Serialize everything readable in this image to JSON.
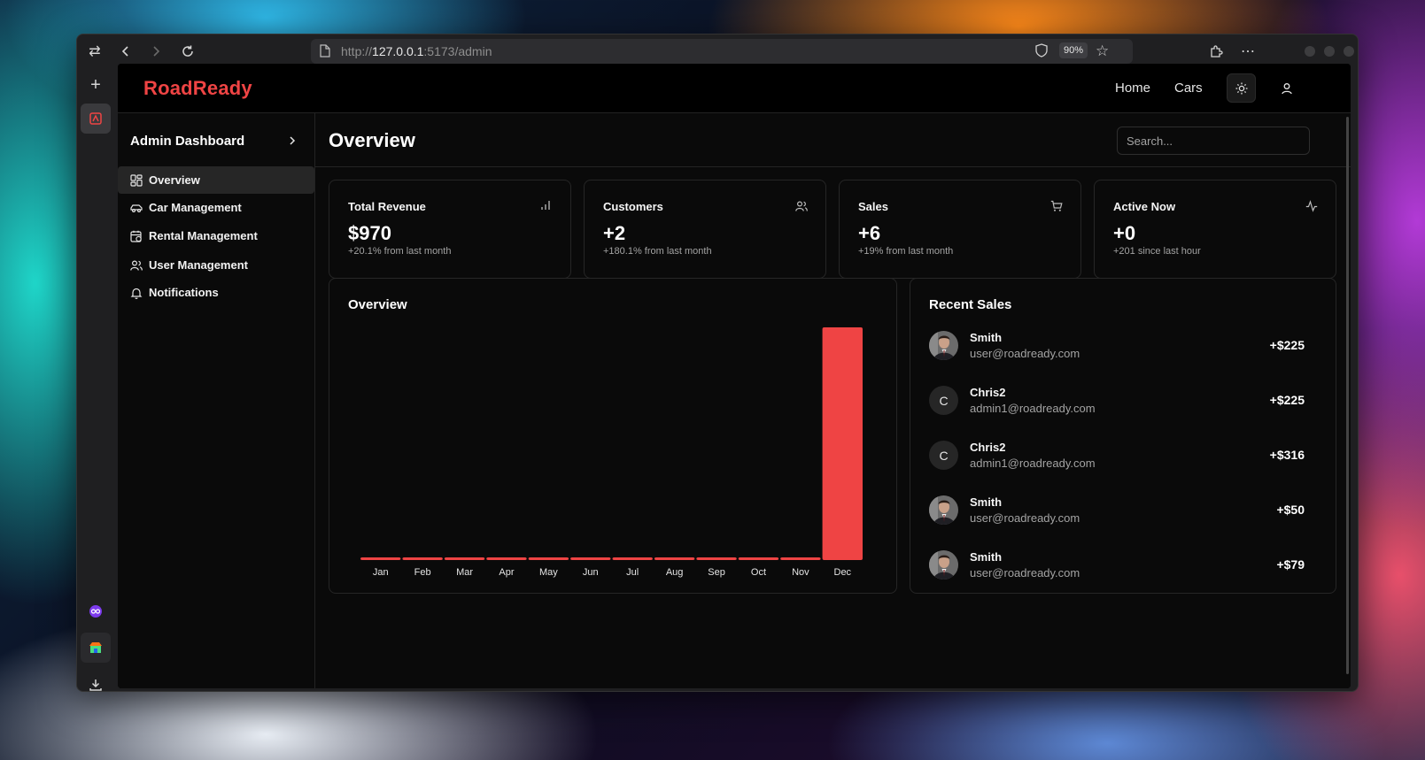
{
  "browser": {
    "url_scheme": "http://",
    "url_host": "127.0.0.1",
    "url_rest": ":5173/admin",
    "zoom": "90%"
  },
  "header": {
    "logo": "RoadReady",
    "nav": [
      "Home",
      "Cars"
    ]
  },
  "sidebar": {
    "title": "Admin Dashboard",
    "items": [
      {
        "label": "Overview",
        "icon": "layout-dashboard-icon",
        "active": true
      },
      {
        "label": "Car Management",
        "icon": "car-icon",
        "active": false
      },
      {
        "label": "Rental Management",
        "icon": "calendar-clock-icon",
        "active": false
      },
      {
        "label": "User Management",
        "icon": "users-icon",
        "active": false
      },
      {
        "label": "Notifications",
        "icon": "bell-icon",
        "active": false
      }
    ]
  },
  "main": {
    "title": "Overview",
    "search_placeholder": "Search...",
    "stats": [
      {
        "title": "Total Revenue",
        "value": "$970",
        "sub": "+20.1% from last month",
        "icon": "bar-chart-icon"
      },
      {
        "title": "Customers",
        "value": "+2",
        "sub": "+180.1% from last month",
        "icon": "users-icon"
      },
      {
        "title": "Sales",
        "value": "+6",
        "sub": "+19% from last month",
        "icon": "shopping-cart-icon"
      },
      {
        "title": "Active Now",
        "value": "+0",
        "sub": "+201 since last hour",
        "icon": "activity-icon"
      }
    ],
    "overview_title": "Overview",
    "recent_sales_title": "Recent Sales",
    "recent_sales": [
      {
        "name": "Smith",
        "email": "user@roadready.com",
        "amount": "+$225",
        "avatar": "photo",
        "initial": ""
      },
      {
        "name": "Chris2",
        "email": "admin1@roadready.com",
        "amount": "+$225",
        "avatar": "initial",
        "initial": "C"
      },
      {
        "name": "Chris2",
        "email": "admin1@roadready.com",
        "amount": "+$316",
        "avatar": "initial",
        "initial": "C"
      },
      {
        "name": "Smith",
        "email": "user@roadready.com",
        "amount": "+$50",
        "avatar": "photo",
        "initial": ""
      },
      {
        "name": "Smith",
        "email": "user@roadready.com",
        "amount": "+$79",
        "avatar": "photo",
        "initial": ""
      }
    ]
  },
  "colors": {
    "accent": "#ef4444",
    "background": "#0a0a0a",
    "border": "#262626"
  },
  "chart_data": {
    "type": "bar",
    "categories": [
      "Jan",
      "Feb",
      "Mar",
      "Apr",
      "May",
      "Jun",
      "Jul",
      "Aug",
      "Sep",
      "Oct",
      "Nov",
      "Dec"
    ],
    "values": [
      0,
      0,
      0,
      0,
      0,
      0,
      0,
      0,
      0,
      0,
      0,
      970
    ],
    "title": "",
    "xlabel": "",
    "ylabel": "",
    "ylim": [
      0,
      970
    ],
    "grid": false,
    "color": "#ef4444"
  }
}
